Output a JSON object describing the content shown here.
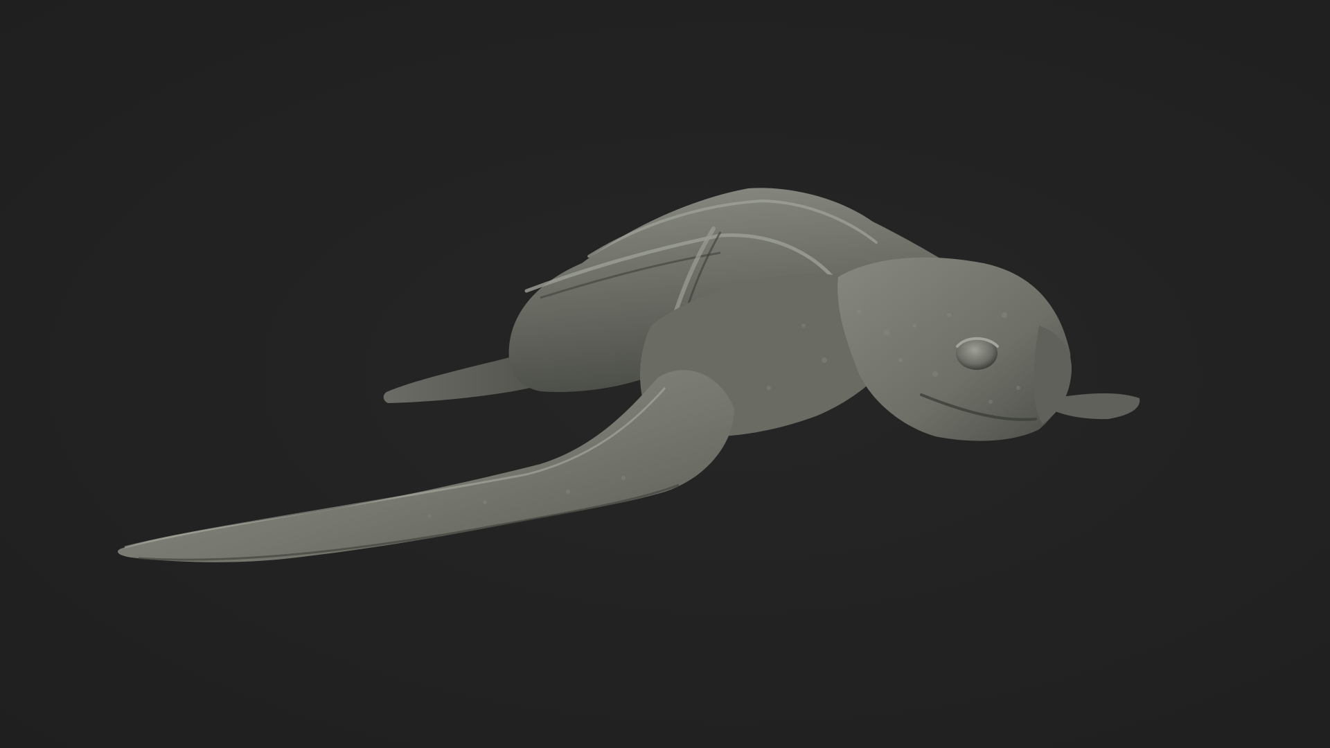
{
  "scene": {
    "subject": "sculpted-sea-turtle-model",
    "colors": {
      "background": "#222222",
      "clay_base": "#6f7168",
      "clay_light": "#9a9c93",
      "clay_dark": "#3c3e38",
      "clay_shadow": "#2b2c28"
    }
  }
}
